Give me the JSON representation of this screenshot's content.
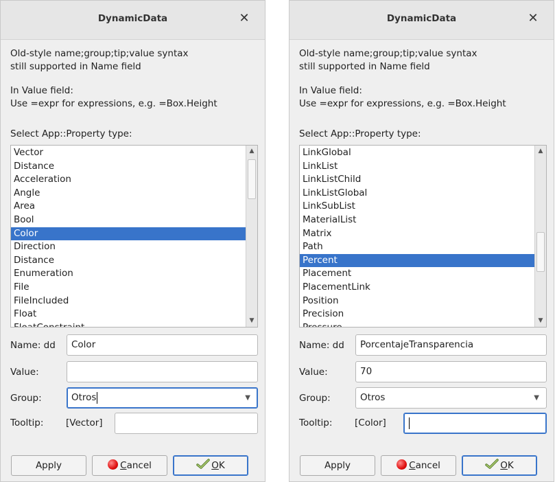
{
  "dialogs": [
    {
      "title": "DynamicData",
      "close": "✕",
      "info_line1": "Old-style name;group;tip;value syntax",
      "info_line2": "still supported in Name field",
      "info_line3": "In Value field:",
      "info_line4": "Use =expr for expressions, e.g. =Box.Height",
      "select_label": "Select App::Property type:",
      "items": [
        "Vector",
        "Distance",
        "Acceleration",
        "Angle",
        "Area",
        "Bool",
        "Color",
        "Direction",
        "Distance",
        "Enumeration",
        "File",
        "FileIncluded",
        "Float",
        "FloatConstraint"
      ],
      "selected": "Color",
      "name_label": "Name: dd",
      "name_value": "Color",
      "value_label": "Value:",
      "value_value": "",
      "group_label": "Group:",
      "group_value": "Otros",
      "tooltip_label": "Tooltip:",
      "tooltip_type": "[Vector]",
      "tooltip_value": "",
      "buttons": {
        "apply": "Apply",
        "cancel_first": "C",
        "cancel_rest": "ancel",
        "ok_first": "O",
        "ok_rest": "K"
      }
    },
    {
      "title": "DynamicData",
      "close": "✕",
      "info_line1": "Old-style name;group;tip;value syntax",
      "info_line2": "still supported in Name field",
      "info_line3": "In Value field:",
      "info_line4": "Use =expr for expressions, e.g. =Box.Height",
      "select_label": "Select App::Property type:",
      "items": [
        "LinkGlobal",
        "LinkList",
        "LinkListChild",
        "LinkListGlobal",
        "LinkSubList",
        "MaterialList",
        "Matrix",
        "Path",
        "Percent",
        "Placement",
        "PlacementLink",
        "Position",
        "Precision",
        "Pressure"
      ],
      "selected": "Percent",
      "name_label": "Name: dd",
      "name_value": "PorcentajeTransparencia",
      "value_label": "Value:",
      "value_value": "70",
      "group_label": "Group:",
      "group_value": "Otros",
      "tooltip_label": "Tooltip:",
      "tooltip_type": "[Color]",
      "tooltip_value": "",
      "buttons": {
        "apply": "Apply",
        "cancel_first": "C",
        "cancel_rest": "ancel",
        "ok_first": "O",
        "ok_rest": "K"
      }
    }
  ],
  "colors": {
    "selection": "#3874ca",
    "dialog_bg": "#efefef",
    "focus": "#3874ca"
  },
  "icons": [
    "close-icon",
    "scroll-up-icon",
    "scroll-down-icon",
    "dropdown-arrow-icon",
    "cancel-icon",
    "ok-checkmark-icon"
  ]
}
